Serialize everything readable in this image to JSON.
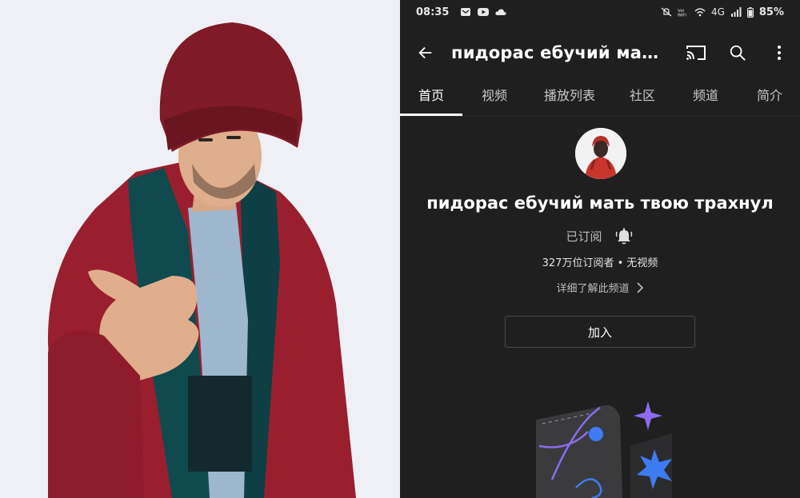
{
  "status_bar": {
    "time": "08:35",
    "left_icons": [
      "mail-icon",
      "youtube-icon",
      "cloud-icon"
    ],
    "right_icons": [
      "mute-icon",
      "vowifi-icon",
      "wifi-icon",
      "signal-icon"
    ],
    "network": "4G",
    "battery": "85%"
  },
  "app_bar": {
    "title": "пидорас ебучий мать т...",
    "icons": [
      "back-arrow-icon",
      "cast-icon",
      "search-icon",
      "more-vert-icon"
    ]
  },
  "tabs": [
    {
      "label": "首页",
      "active": true
    },
    {
      "label": "视频",
      "active": false
    },
    {
      "label": "播放列表",
      "active": false
    },
    {
      "label": "社区",
      "active": false
    },
    {
      "label": "频道",
      "active": false
    },
    {
      "label": "简介",
      "active": false
    }
  ],
  "channel": {
    "name": "пидорас ебучий мать твою трахнул",
    "subscribed_label": "已订阅",
    "stats": "327万位订阅者 • 无视频",
    "more_link": "详细了解此频道",
    "join_label": "加入"
  },
  "colors": {
    "phone_background": "#1f1f1f",
    "text_primary": "#ffffff",
    "text_secondary": "#bdbdbd",
    "photo_background": "#eef0f5",
    "beanie": "#8a1f2c",
    "coat": "#9a1f2e",
    "accent_purple": "#8b6cf0",
    "accent_blue": "#3d7cf2"
  }
}
